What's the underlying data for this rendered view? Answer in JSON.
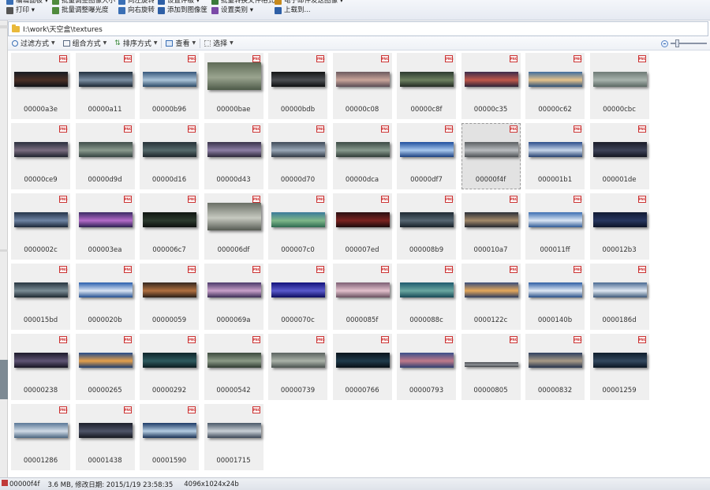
{
  "toolbar": {
    "row1": [
      {
        "label": "编辑面板 ▾",
        "color": "#3a6fb5"
      },
      {
        "label": "批量调整图像大小",
        "color": "#4f8a3c"
      },
      {
        "label": "向左旋转",
        "color": "#3a6fb5"
      },
      {
        "label": "设置评级 ▾",
        "color": "#2e5fa6"
      },
      {
        "label": "批量转换文件格式",
        "color": "#3b7b3b"
      },
      {
        "label": "电子邮件发送图像 ▾",
        "color": "#c78a1d"
      }
    ],
    "row2": [
      {
        "label": "打印 ▾",
        "color": "#555555"
      },
      {
        "label": "批量调整曝光度",
        "color": "#4f8a3c"
      },
      {
        "label": "向右旋转",
        "color": "#3a6fb5"
      },
      {
        "label": "添加到图像筐",
        "color": "#2e5fa6"
      },
      {
        "label": "设置类别 ▾",
        "color": "#7b4aa8"
      },
      {
        "label": "上载到...",
        "color": "#2e5fa6"
      }
    ]
  },
  "address": {
    "path": "I:\\work\\天空盒\\textures"
  },
  "viewbar": {
    "filter": "过滤方式",
    "group": "组合方式",
    "sort": "排序方式",
    "view": "查看",
    "select": "选择"
  },
  "badge_text": "PNG",
  "files": [
    {
      "name": "00000a3e",
      "colors": [
        "#171b22",
        "#4a2f25",
        "#0e1116"
      ]
    },
    {
      "name": "00000a11",
      "colors": [
        "#22303f",
        "#7b8ea2",
        "#1b2632"
      ]
    },
    {
      "name": "00000b96",
      "colors": [
        "#36577a",
        "#aac3d8",
        "#2b4966"
      ]
    },
    {
      "name": "00000bae",
      "colors": [
        "#5e6b57",
        "#9aa48f",
        "#4d5a48"
      ],
      "shape": "tall"
    },
    {
      "name": "00000bdb",
      "colors": [
        "#141516",
        "#4b4e52",
        "#0d0e10"
      ]
    },
    {
      "name": "00000c08",
      "colors": [
        "#6b5a5f",
        "#c9a59a",
        "#5a4b55"
      ]
    },
    {
      "name": "00000c8f",
      "colors": [
        "#2d3a30",
        "#6d8060",
        "#222a22"
      ]
    },
    {
      "name": "00000c35",
      "colors": [
        "#3b2b4a",
        "#c0584a",
        "#2a2338"
      ]
    },
    {
      "name": "00000c62",
      "colors": [
        "#3f6d9e",
        "#e6c38a",
        "#2b5078"
      ]
    },
    {
      "name": "00000cbc",
      "colors": [
        "#6e7b76",
        "#a8b3ad",
        "#5b6863"
      ]
    },
    {
      "name": "00000ce9",
      "colors": [
        "#2a2f3d",
        "#7a6d80",
        "#1f232d"
      ]
    },
    {
      "name": "00000d9d",
      "colors": [
        "#3f4d4a",
        "#8a9a8e",
        "#344240"
      ]
    },
    {
      "name": "00000d16",
      "colors": [
        "#263138",
        "#566a6b",
        "#1c252a"
      ]
    },
    {
      "name": "00000d43",
      "colors": [
        "#38334a",
        "#8d7fa5",
        "#2b2739"
      ]
    },
    {
      "name": "00000d70",
      "colors": [
        "#3f4a58",
        "#9aa8b8",
        "#2f3844"
      ]
    },
    {
      "name": "00000dca",
      "colors": [
        "#3c4a45",
        "#889a8e",
        "#2f3b37"
      ]
    },
    {
      "name": "00000df7",
      "colors": [
        "#1f4f9e",
        "#a8c8ee",
        "#1a3f80"
      ]
    },
    {
      "name": "00000f4f",
      "colors": [
        "#5a5e62",
        "#b9bcbf",
        "#4d5155"
      ],
      "selected": true
    },
    {
      "name": "000001b1",
      "colors": [
        "#2b4c8a",
        "#c7d6ea",
        "#24406f"
      ]
    },
    {
      "name": "000001de",
      "colors": [
        "#1a1c28",
        "#3e4358",
        "#141620"
      ]
    },
    {
      "name": "0000002c",
      "colors": [
        "#253449",
        "#6f84a4",
        "#1b2638"
      ]
    },
    {
      "name": "000003ea",
      "colors": [
        "#3a2a63",
        "#b46bc9",
        "#2b2050"
      ]
    },
    {
      "name": "000006c7",
      "colors": [
        "#101612",
        "#2c3a2e",
        "#0c100d"
      ]
    },
    {
      "name": "000006df",
      "colors": [
        "#6a6f66",
        "#c6c9c0",
        "#555a52"
      ],
      "shape": "tall"
    },
    {
      "name": "000007c0",
      "colors": [
        "#3b7a9a",
        "#7fb889",
        "#2e6a50"
      ]
    },
    {
      "name": "000007ed",
      "colors": [
        "#2a0f12",
        "#7a2320",
        "#1b0a0c"
      ]
    },
    {
      "name": "000008b9",
      "colors": [
        "#1f2a33",
        "#566672",
        "#162028"
      ]
    },
    {
      "name": "000010a7",
      "colors": [
        "#2b2f38",
        "#a48a6a",
        "#22262e"
      ]
    },
    {
      "name": "000011ff",
      "colors": [
        "#3d6fb2",
        "#dbe6f4",
        "#2f5a95"
      ]
    },
    {
      "name": "000012b3",
      "colors": [
        "#111a33",
        "#27365e",
        "#0c1327"
      ]
    },
    {
      "name": "000015bd",
      "colors": [
        "#273540",
        "#7a8c95",
        "#1d2830"
      ]
    },
    {
      "name": "0000020b",
      "colors": [
        "#2a5fae",
        "#d9e4f3",
        "#234f90"
      ]
    },
    {
      "name": "00000059",
      "colors": [
        "#35281f",
        "#b07040",
        "#281e17"
      ]
    },
    {
      "name": "0000069a",
      "colors": [
        "#4b3a6a",
        "#c8a0c9",
        "#3a2d55"
      ]
    },
    {
      "name": "0000070c",
      "colors": [
        "#12127a",
        "#5a5acc",
        "#0d0d5e"
      ]
    },
    {
      "name": "0000085f",
      "colors": [
        "#7d5f74",
        "#e2c0cc",
        "#68505f"
      ]
    },
    {
      "name": "0000088c",
      "colors": [
        "#1f5a6e",
        "#6aa7a0",
        "#174856"
      ]
    },
    {
      "name": "0000122c",
      "colors": [
        "#3a4e7a",
        "#e5a85a",
        "#2c3c60"
      ]
    },
    {
      "name": "0000140b",
      "colors": [
        "#2f5fa5",
        "#e0e9f5",
        "#284f88"
      ]
    },
    {
      "name": "0000186d",
      "colors": [
        "#4a6a92",
        "#dfe8f2",
        "#3c5878"
      ]
    },
    {
      "name": "00000238",
      "colors": [
        "#1d1a2b",
        "#5f5474",
        "#161422"
      ]
    },
    {
      "name": "00000265",
      "colors": [
        "#234b8a",
        "#e6a04a",
        "#1c3d70"
      ]
    },
    {
      "name": "00000292",
      "colors": [
        "#0f2429",
        "#2e5a5e",
        "#0b1b1f"
      ]
    },
    {
      "name": "00000542",
      "colors": [
        "#3c4a3e",
        "#8b9a86",
        "#2f3a31"
      ]
    },
    {
      "name": "00000739",
      "colors": [
        "#5b6360",
        "#aab2a8",
        "#4a524f"
      ]
    },
    {
      "name": "00000766",
      "colors": [
        "#0a141c",
        "#1f3a4a",
        "#070f15"
      ]
    },
    {
      "name": "00000793",
      "colors": [
        "#3a4f8a",
        "#c07a8a",
        "#2e3f70"
      ]
    },
    {
      "name": "00000805",
      "colors": [
        "#4a4d52",
        "#8e9196",
        "#3a3d42"
      ],
      "shape": "thin"
    },
    {
      "name": "00000832",
      "colors": [
        "#2f4060",
        "#a89a86",
        "#24334d"
      ]
    },
    {
      "name": "00001259",
      "colors": [
        "#0f1d2c",
        "#33485e",
        "#0b1622"
      ]
    },
    {
      "name": "00001286",
      "colors": [
        "#5a7797",
        "#d0dbe6",
        "#4a6580"
      ]
    },
    {
      "name": "00001438",
      "colors": [
        "#1c1f2a",
        "#4e5468",
        "#15171f"
      ]
    },
    {
      "name": "00001590",
      "colors": [
        "#1d3a66",
        "#b4cce2",
        "#183154"
      ]
    },
    {
      "name": "00001715",
      "colors": [
        "#4a5868",
        "#c9d0d6",
        "#3c4756"
      ]
    }
  ],
  "status": {
    "filename": "00000f4f",
    "size_date": "3.6 MB, 修改日期: 2015/1/19 23:58:35",
    "dimensions": "4096x1024x24b"
  }
}
